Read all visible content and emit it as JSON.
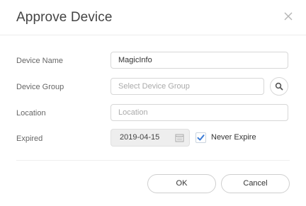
{
  "dialog": {
    "title": "Approve Device"
  },
  "form": {
    "device_name": {
      "label": "Device Name",
      "value": "MagicInfo"
    },
    "device_group": {
      "label": "Device Group",
      "placeholder": "Select Device Group"
    },
    "location": {
      "label": "Location",
      "placeholder": "Location"
    },
    "expired": {
      "label": "Expired",
      "date": "2019-04-15",
      "never_expire_label": "Never Expire",
      "never_expire_checked": true
    }
  },
  "buttons": {
    "ok": "OK",
    "cancel": "Cancel"
  },
  "icons": {
    "close": "close-icon",
    "search": "search-icon",
    "calendar": "calendar-icon",
    "check": "check-icon"
  },
  "colors": {
    "checkbox_accent": "#3b7bd6"
  }
}
